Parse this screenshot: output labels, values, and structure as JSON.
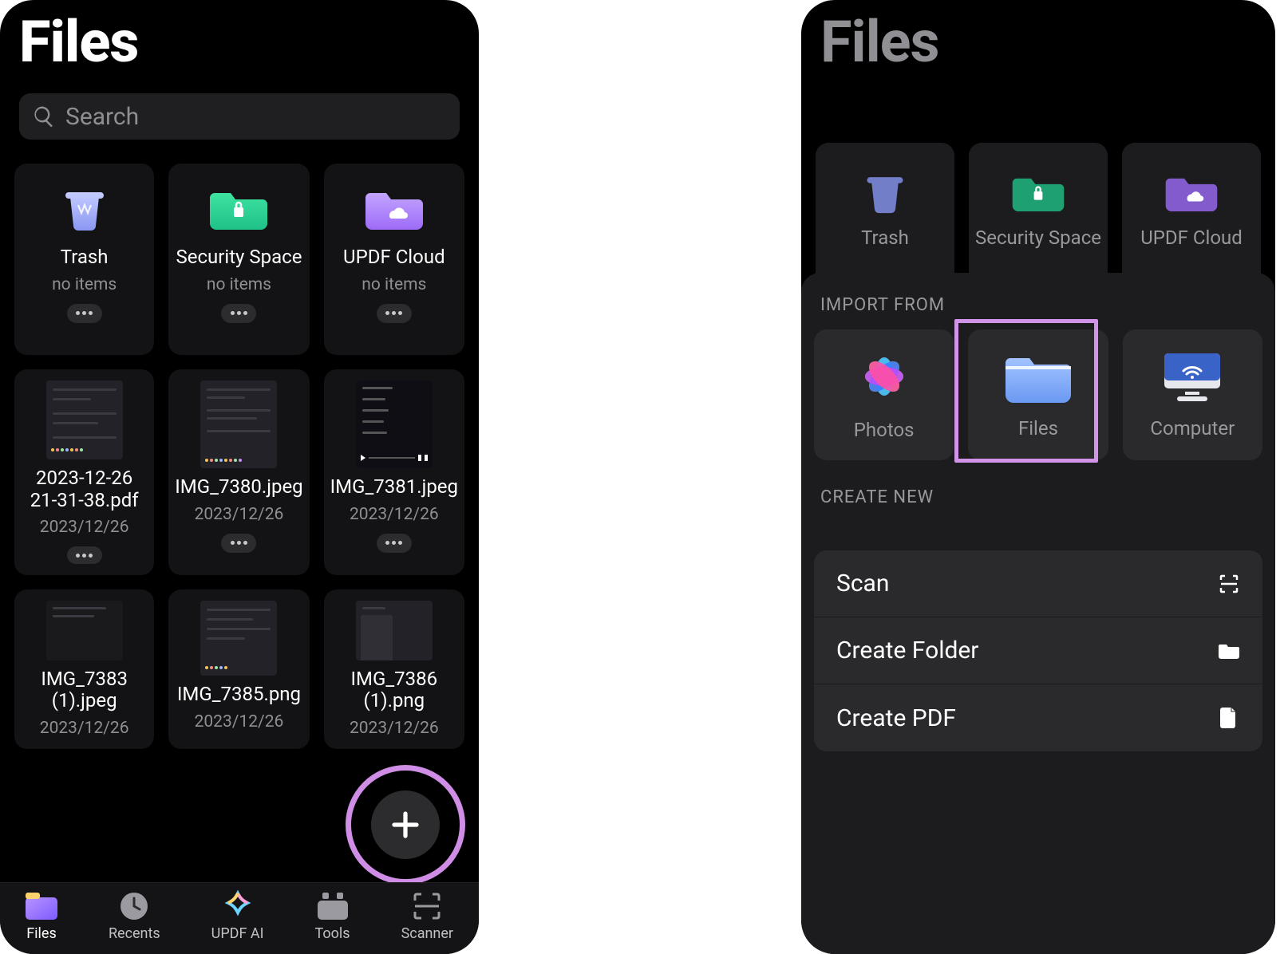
{
  "left": {
    "title": "Files",
    "search_placeholder": "Search",
    "folders": [
      {
        "name": "Trash",
        "sub": "no items",
        "icon": "trash"
      },
      {
        "name": "Security Space",
        "sub": "no items",
        "icon": "lock-folder"
      },
      {
        "name": "UPDF Cloud",
        "sub": "no items",
        "icon": "cloud-folder"
      }
    ],
    "files": [
      {
        "name": "2023-12-26 21-31-38.pdf",
        "date": "2023/12/26",
        "thumb": "chat"
      },
      {
        "name": "IMG_7380.jpeg",
        "date": "2023/12/26",
        "thumb": "chat"
      },
      {
        "name": "IMG_7381.jpeg",
        "date": "2023/12/26",
        "thumb": "player"
      },
      {
        "name": "IMG_7383 (1).jpeg",
        "date": "2023/12/26",
        "thumb": "dark"
      },
      {
        "name": "IMG_7385.png",
        "date": "2023/12/26",
        "thumb": "list"
      },
      {
        "name": "IMG_7386 (1).png",
        "date": "2023/12/26",
        "thumb": "files"
      }
    ],
    "tabs": [
      {
        "label": "Files",
        "icon": "folder",
        "active": true
      },
      {
        "label": "Recents",
        "icon": "clock",
        "active": false
      },
      {
        "label": "UPDF AI",
        "icon": "spark",
        "active": false
      },
      {
        "label": "Tools",
        "icon": "toolbox",
        "active": false
      },
      {
        "label": "Scanner",
        "icon": "scan",
        "active": false
      }
    ]
  },
  "right": {
    "title": "Files",
    "folders": [
      {
        "name": "Trash",
        "icon": "trash"
      },
      {
        "name": "Security Space",
        "icon": "lock-folder"
      },
      {
        "name": "UPDF Cloud",
        "icon": "cloud-folder"
      }
    ],
    "sheet": {
      "import_label": "IMPORT FROM",
      "import": [
        {
          "label": "Photos",
          "icon": "photos"
        },
        {
          "label": "Files",
          "icon": "folder-blue",
          "highlighted": true
        },
        {
          "label": "Computer",
          "icon": "computer"
        }
      ],
      "create_label": "CREATE NEW",
      "create": [
        {
          "label": "Scan",
          "icon": "scan"
        },
        {
          "label": "Create Folder",
          "icon": "folder-mini"
        },
        {
          "label": "Create PDF",
          "icon": "doc"
        }
      ]
    }
  }
}
